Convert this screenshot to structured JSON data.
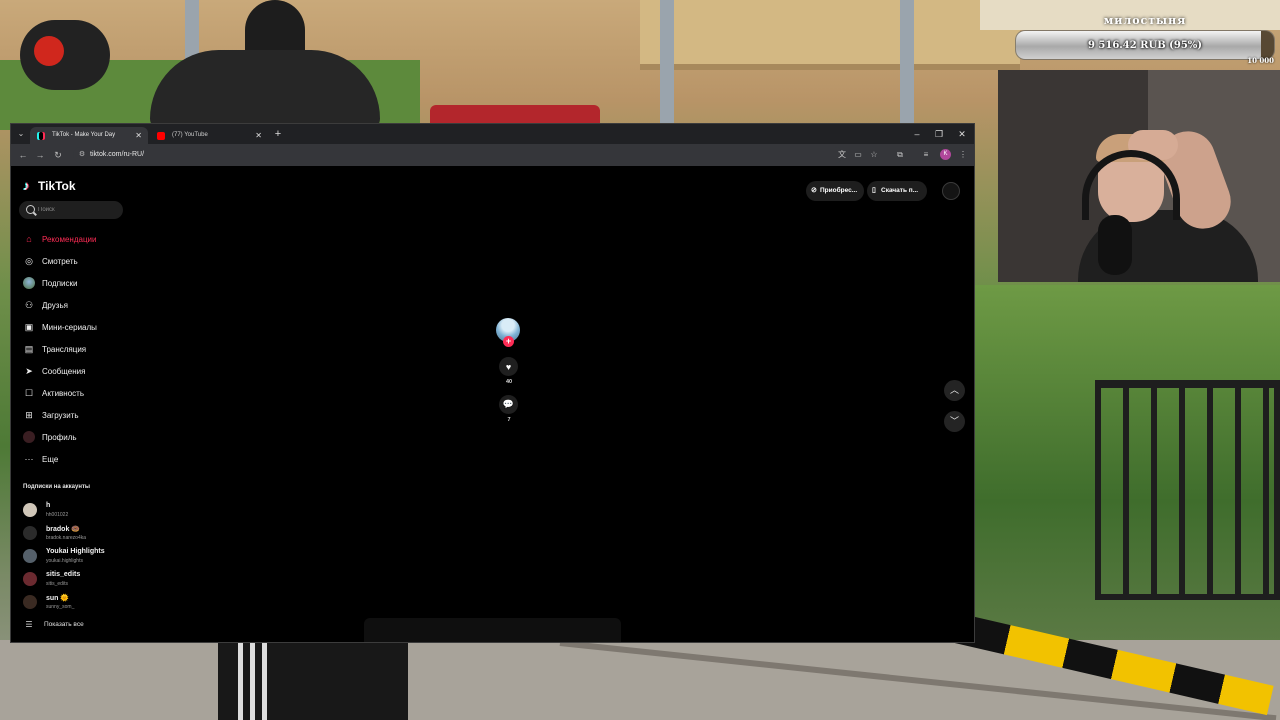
{
  "donation": {
    "title": "милостыня",
    "amount": "9 516.42 RUB (95%)",
    "progress_pct": 95,
    "goal": "10 000"
  },
  "browser": {
    "tabs": [
      {
        "title": "TikTok - Make Your Day",
        "active": true
      },
      {
        "title": "(77) YouTube",
        "active": false
      }
    ],
    "url": "tiktok.com/ru-RU/",
    "profile_initial": "K"
  },
  "tiktok": {
    "logo": "TikTok",
    "search_placeholder": "Поиск",
    "nav": [
      {
        "label": "Рекомендации",
        "icon": "home-icon",
        "active": true
      },
      {
        "label": "Смотреть",
        "icon": "compass-icon"
      },
      {
        "label": "Подписки",
        "icon": "avatar-icon"
      },
      {
        "label": "Друзья",
        "icon": "friends-icon"
      },
      {
        "label": "Мини-сериалы",
        "icon": "series-icon"
      },
      {
        "label": "Трансляция",
        "icon": "live-icon"
      },
      {
        "label": "Сообщения",
        "icon": "send-icon"
      },
      {
        "label": "Активность",
        "icon": "activity-icon"
      },
      {
        "label": "Загрузить",
        "icon": "upload-icon"
      },
      {
        "label": "Профиль",
        "icon": "profile-icon"
      },
      {
        "label": "Еще",
        "icon": "more-icon"
      }
    ],
    "following_title": "Подписки на аккаунты",
    "following": [
      {
        "name": "h",
        "handle": "hh001022",
        "color": "#cfc6b8"
      },
      {
        "name": "bradok 🍩",
        "handle": "bradok.narezo4ka",
        "color": "#2b2b2b"
      },
      {
        "name": "Youkai Highlights",
        "handle": "youkai.highlights",
        "color": "#55606a"
      },
      {
        "name": "sitis_edits",
        "handle": "sitis_edits",
        "color": "#6b2a30"
      },
      {
        "name": "sun 🌞",
        "handle": "sunny_som_",
        "color": "#3a2a22"
      }
    ],
    "show_all": "Показать все",
    "top_actions": {
      "get_coins": "Приобрес...",
      "download": "Скачать п..."
    },
    "actions": {
      "likes": "40",
      "comments": "7"
    }
  }
}
